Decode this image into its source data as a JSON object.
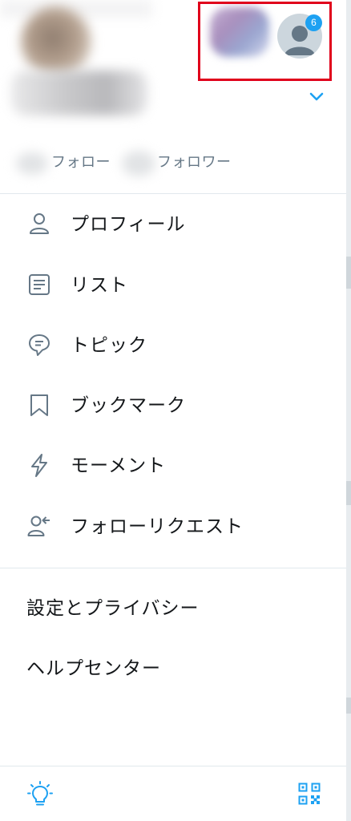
{
  "header": {
    "notification_badge": "6",
    "following_label": "フォロー",
    "followers_label": "フォロワー"
  },
  "menu": {
    "items": [
      {
        "label": "プロフィール",
        "icon": "person-icon"
      },
      {
        "label": "リスト",
        "icon": "list-icon"
      },
      {
        "label": "トピック",
        "icon": "topic-icon"
      },
      {
        "label": "ブックマーク",
        "icon": "bookmark-icon"
      },
      {
        "label": "モーメント",
        "icon": "lightning-icon"
      },
      {
        "label": "フォローリクエスト",
        "icon": "follow-request-icon"
      }
    ],
    "settings_label": "設定とプライバシー",
    "help_label": "ヘルプセンター"
  },
  "footer": {
    "left_icon": "lightbulb-icon",
    "right_icon": "qr-code-icon"
  },
  "colors": {
    "accent": "#1da1f2",
    "icon_gray": "#657786",
    "highlight": "#e0001b",
    "divider": "#e1e8ed"
  }
}
